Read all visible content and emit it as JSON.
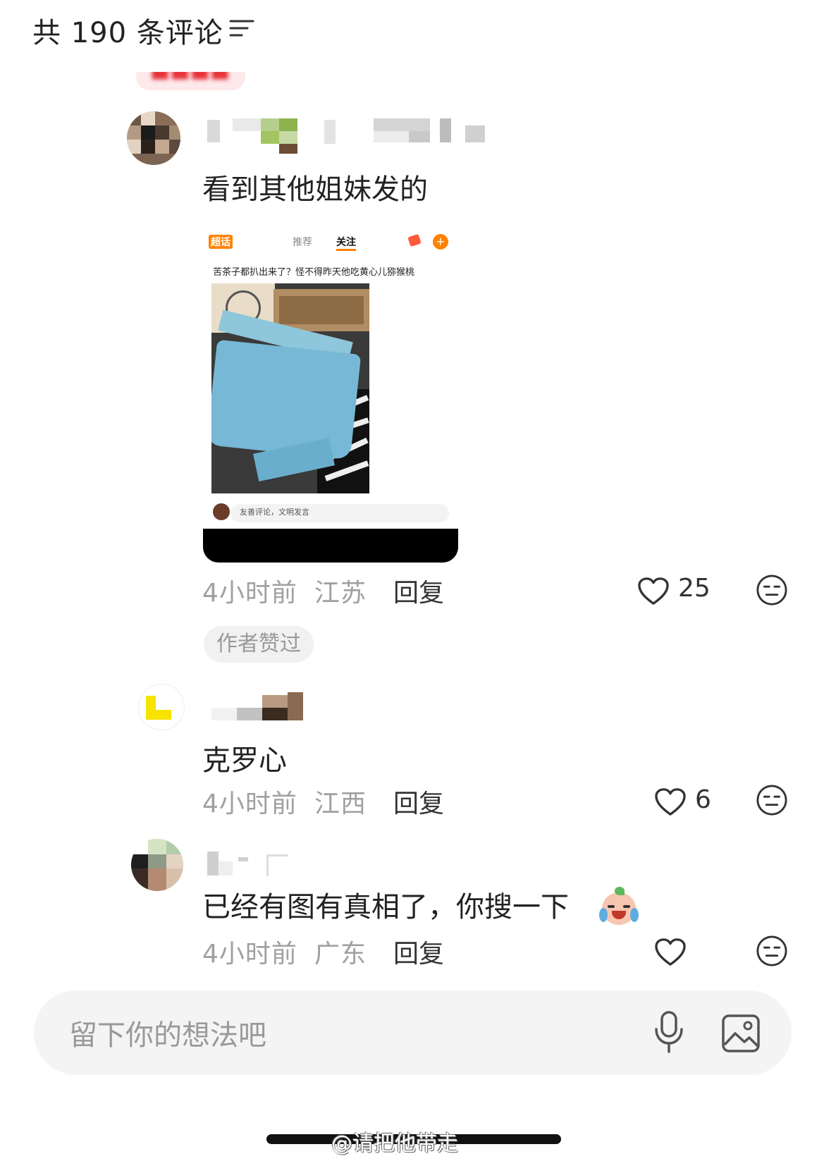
{
  "header": {
    "title": "共 190 条评论",
    "filter_icon": "filter-icon"
  },
  "comments": [
    {
      "text": "看到其他姐妹发的",
      "time": "4小时前",
      "location": "江苏",
      "reply_label": "回复",
      "likes": "25",
      "badge": "作者赞过",
      "embedded_screenshot": {
        "tabs": [
          "超话",
          "推荐",
          "关注"
        ],
        "caption": "苦茶子都扒出来了？怪不得昨天他吃黄心儿猕猴桃",
        "input_placeholder": "友善评论，文明发言"
      }
    },
    {
      "text": "克罗心",
      "time": "4小时前",
      "location": "江西",
      "reply_label": "回复",
      "likes": "6"
    },
    {
      "text": "已经有图有真相了，你搜一下",
      "time": "4小时前",
      "location": "广东",
      "reply_label": "回复",
      "likes": ""
    }
  ],
  "input": {
    "placeholder": "留下你的想法吧"
  },
  "watermark": "@请把他带走",
  "colors": {
    "accent_red": "#e8323a",
    "muted_text": "#a0a0a0",
    "input_bg": "#f4f4f5",
    "weibo_orange": "#ff8200"
  }
}
